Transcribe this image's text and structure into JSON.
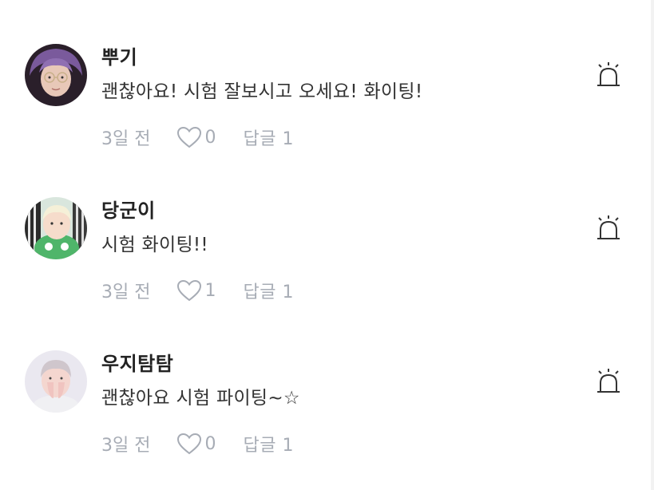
{
  "comments": [
    {
      "username": "당군이",
      "text": "시험 화이팅!!",
      "time": "3일 전",
      "likes": "1",
      "reply_label": "답글 1",
      "avatar_icon": "user-avatar-icon",
      "report_icon": "siren-icon"
    },
    {
      "username": "우지탐탐",
      "text": "괜찮아요 시험 파이팅~☆",
      "time": "3일 전",
      "likes": "0",
      "reply_label": "답글 1",
      "avatar_icon": "user-avatar-icon",
      "report_icon": "siren-icon"
    },
    {
      "username": "뿌기",
      "text": "괜찮아요! 시험 잘보시고 오세요! 화이팅!",
      "time": "3일 전",
      "likes": "0",
      "reply_label": "답글 1",
      "avatar_icon": "user-avatar-icon",
      "report_icon": "siren-icon"
    }
  ],
  "colors": {
    "meta_gray": "#a7acb5",
    "text_dark": "#222222",
    "icon_dark": "#333333"
  }
}
